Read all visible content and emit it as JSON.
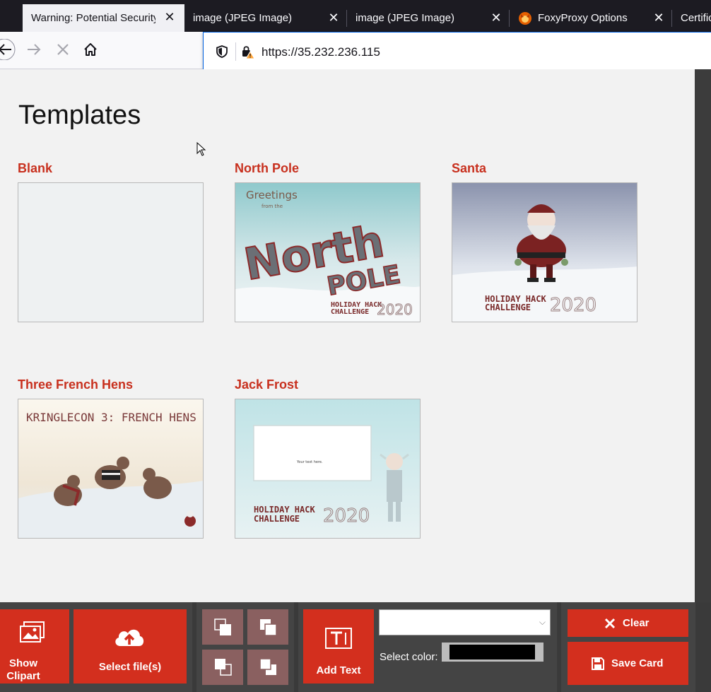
{
  "browser": {
    "tabs": [
      {
        "title": "Warning: Potential Security",
        "active": true
      },
      {
        "title": "image (JPEG Image)",
        "active": false
      },
      {
        "title": "image (JPEG Image)",
        "active": false
      },
      {
        "title": "FoxyProxy Options",
        "active": false
      },
      {
        "title": "Certific",
        "active": false
      }
    ],
    "url": "https://35.232.236.115"
  },
  "page": {
    "title": "Templates",
    "templates": [
      {
        "name": "Blank"
      },
      {
        "name": "North Pole",
        "thumb_text": {
          "greetings": "Greetings",
          "from": "from the",
          "north": "North",
          "pole": "POLE",
          "hhc1": "HOLIDAY HACK",
          "hhc2": "CHALLENGE",
          "year": "2020"
        }
      },
      {
        "name": "Santa",
        "thumb_text": {
          "hhc1": "HOLIDAY HACK",
          "hhc2": "CHALLENGE",
          "year": "2020"
        }
      },
      {
        "name": "Three French Hens",
        "thumb_text": {
          "banner": "KRINGLECON 3: FRENCH HENS"
        }
      },
      {
        "name": "Jack Frost",
        "thumb_text": {
          "placeholder": "Your text here.",
          "hhc1": "HOLIDAY HACK",
          "hhc2": "CHALLENGE",
          "year": "2020"
        }
      }
    ]
  },
  "toolbar": {
    "show_clipart": "Show Clipart",
    "select_files": "Select file(s)",
    "add_text": "Add Text",
    "select_color_label": "Select color:",
    "clear": "Clear",
    "save_card": "Save Card",
    "selected_color": "#000000",
    "accent_color": "#d32f1e"
  }
}
